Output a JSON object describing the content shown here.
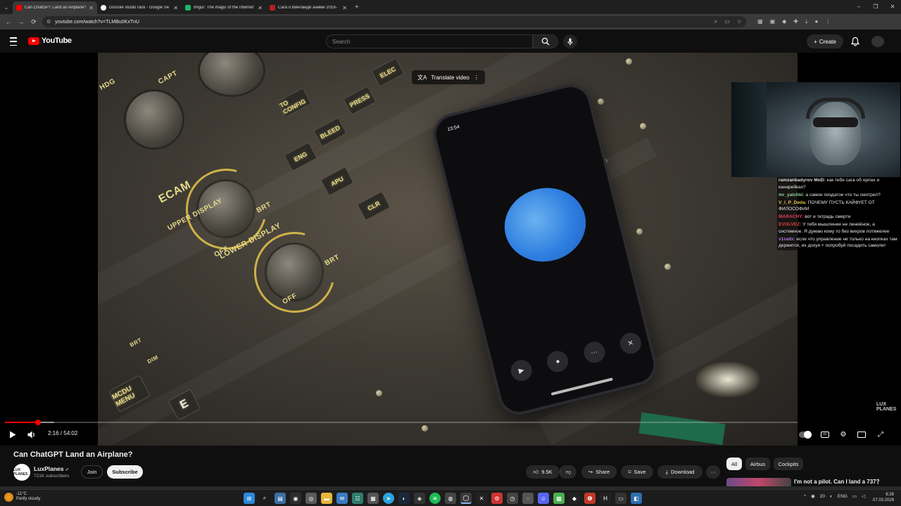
{
  "browser": {
    "tabs": [
      {
        "label": "Can ChatGPT Land an Airplane?",
        "active": true,
        "favicon_color": "#ff0000"
      },
      {
        "label": "console studio rack - Google Se",
        "active": false,
        "favicon_color": "#ffffff"
      },
      {
        "label": "Imgur: The magic of the Internet",
        "active": false,
        "favicon_color": "#1bb76e"
      },
      {
        "label": "Сага о Винланде аниме 2019-",
        "active": false,
        "favicon_color": "#b32020"
      }
    ],
    "new_tab": "+",
    "url": "youtube.com/watch?v=TLMBu0KxTnU",
    "window_controls": [
      "–",
      "❐",
      "✕"
    ]
  },
  "youtube": {
    "logo_text": "YouTube",
    "search_placeholder": "Search",
    "create_label": "Create"
  },
  "video": {
    "translate_label": "Translate video",
    "watermark": "LUX PLANES",
    "phone_time": "13:54",
    "time_current": "2:16",
    "time_total": "54:02",
    "time_display": "2:16 / 54:02",
    "played_fraction": 0.042,
    "loaded_fraction": 0.062
  },
  "cockpit_labels": {
    "ecam": "ECAM",
    "upper_display": "UPPER DISPLAY",
    "lower_display": "LOWER DISPLAY",
    "brt": "BRT",
    "off": "OFF",
    "eng": "ENG",
    "apu": "APU",
    "bleed": "BLEED",
    "press": "PRESS",
    "elec": "ELEC",
    "to_config": "TO CONFIG",
    "clr": "CLR",
    "mcdu_menu": "MCDU MENU",
    "e_key": "E",
    "hdg": "HDG",
    "capt": "CAPT",
    "dim": "DIM"
  },
  "chat": [
    {
      "user": "ramzankadyrov MoD:",
      "color": "#e0e0e0",
      "text": "как тебе сага об орлах и канарейках?"
    },
    {
      "user": "mr_yaichki:",
      "color": "#8fd694",
      "text": "а самое пиздатое что ты смотрел?"
    },
    {
      "user": "V_I_P_Deda:",
      "color": "#e8c24a",
      "text": "ПОЧЕМУ ПУСТЬ КАЙФУЕТ ОТ ФИЛОСОФИИ"
    },
    {
      "user": "MARACHY:",
      "color": "#e04060",
      "text": "вот и тетрадь смерти"
    },
    {
      "user": "EVOLVEZ:",
      "color": "#e04040",
      "text": "У тебя мышление не линейное, а системное. Я думаю кому то без вихров потяжелее"
    },
    {
      "user": "v1radx:",
      "color": "#b07ae0",
      "text": "если что управление не только на кнопках там держится, их дохуя + попробуй посадить самолет"
    }
  ],
  "below": {
    "title": "Can ChatGPT Land an Airplane?",
    "channel": "LuxPlanes",
    "verified": "✔",
    "channel_avatar_text": "LUX PLANES",
    "subscribers": "721K subscribers",
    "join": "Join",
    "subscribe": "Subscribe",
    "likes": "9.5K",
    "share": "Share",
    "save": "Save",
    "download": "Download",
    "more": "···"
  },
  "chips": [
    "All",
    "Airbus",
    "Cockpits"
  ],
  "recommendation": {
    "title": "I'm not a pilot. Can I land a 737?",
    "more": "⋮"
  },
  "taskbar": {
    "weather_temp": "-11°C",
    "weather_desc": "Partly cloudy",
    "lang": "ENG",
    "time": "6:26",
    "date": "07.03.2026",
    "volume": "20"
  }
}
